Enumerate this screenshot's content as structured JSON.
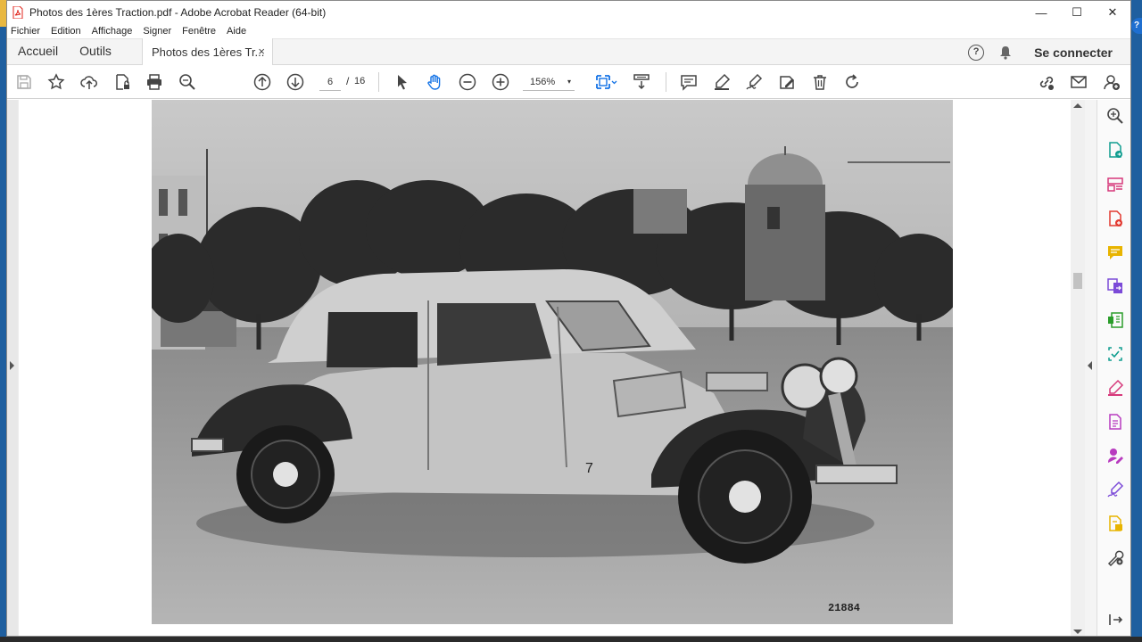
{
  "window": {
    "title": "Photos des 1ères Traction.pdf - Adobe Acrobat Reader (64-bit)",
    "controls": [
      "—",
      "☐",
      "✕"
    ]
  },
  "menu": [
    "Fichier",
    "Edition",
    "Affichage",
    "Signer",
    "Fenêtre",
    "Aide"
  ],
  "tabs": {
    "home": "Accueil",
    "tools": "Outils",
    "document": "Photos des 1ères Tr...",
    "close": "×"
  },
  "account": {
    "help": "?",
    "signin": "Se connecter"
  },
  "toolbar": {
    "current_page": "6",
    "separator": "/",
    "total_pages": "16",
    "zoom": "156%",
    "zoom_caret": "▾"
  },
  "photo": {
    "car_number": "7",
    "serial": "21884"
  },
  "colors": {
    "accent_blue": "#1473e6",
    "pdf_red": "#e0261c",
    "rail_teal": "#0f9d8f",
    "rail_pink": "#d6387a",
    "rail_red": "#e23a31",
    "rail_yellow": "#e8b400",
    "rail_purple": "#7b4ad8",
    "rail_green": "#2a9d2a",
    "rail_magenta": "#b83bbf"
  },
  "icons": {
    "toolbar": [
      "save-icon",
      "bookmark-star-icon",
      "upload-cloud-icon",
      "protect-file-icon",
      "print-icon",
      "find-text-icon",
      "previous-page-icon",
      "next-page-icon",
      "select-cursor-icon",
      "hand-tool-icon",
      "zoom-out-icon",
      "zoom-in-icon",
      "fit-page-icon",
      "scroll-mode-icon",
      "comment-icon",
      "highlight-pen-icon",
      "draw-signature-icon",
      "fill-sign-icon",
      "delete-icon",
      "rotate-icon",
      "share-link-icon",
      "email-icon",
      "add-user-icon"
    ],
    "rail": [
      "zoom-search-icon",
      "export-pdf-icon",
      "organize-pages-icon",
      "create-pdf-icon",
      "comment-tool-icon",
      "combine-files-icon",
      "compress-pdf-icon",
      "scan-ocr-icon",
      "fill-sign-rail-icon",
      "edit-pdf-icon",
      "request-signature-icon",
      "sign-icon",
      "stamp-icon",
      "more-tools-icon",
      "collapse-rail-icon"
    ]
  }
}
